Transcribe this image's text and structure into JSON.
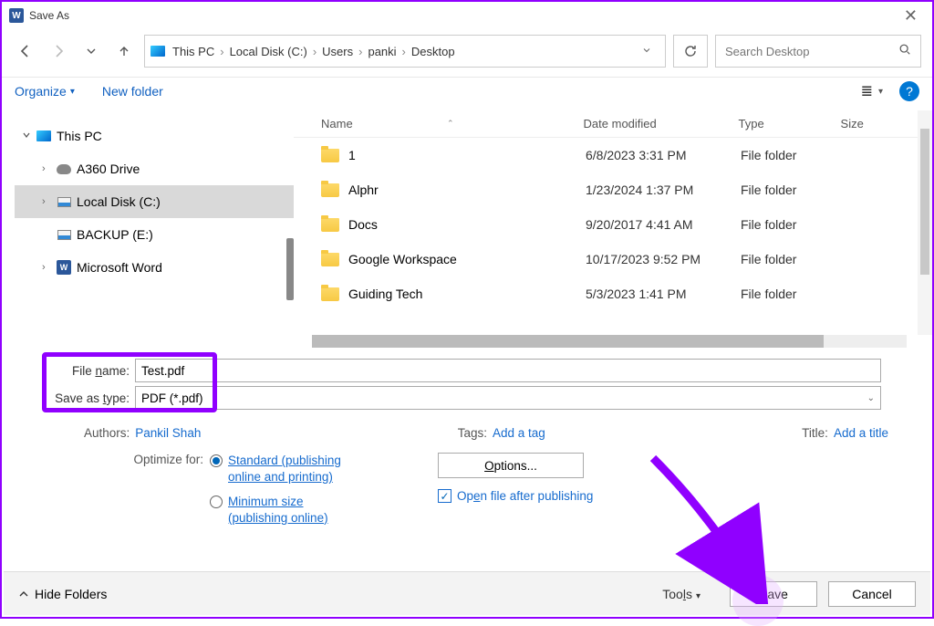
{
  "window": {
    "title": "Save As"
  },
  "breadcrumb": [
    "This PC",
    "Local Disk (C:)",
    "Users",
    "panki",
    "Desktop"
  ],
  "search": {
    "placeholder": "Search Desktop"
  },
  "toolbar": {
    "organize": "Organize",
    "new_folder": "New folder"
  },
  "tree": {
    "root": "This PC",
    "items": [
      {
        "label": "A360 Drive",
        "icon": "cloud"
      },
      {
        "label": "Local Disk (C:)",
        "icon": "disk",
        "selected": true
      },
      {
        "label": "BACKUP (E:)",
        "icon": "disk"
      },
      {
        "label": "Microsoft Word",
        "icon": "word"
      }
    ]
  },
  "columns": {
    "name": "Name",
    "mod": "Date modified",
    "type": "Type",
    "size": "Size"
  },
  "files": [
    {
      "name": "1",
      "mod": "6/8/2023 3:31 PM",
      "type": "File folder"
    },
    {
      "name": "Alphr",
      "mod": "1/23/2024 1:37 PM",
      "type": "File folder"
    },
    {
      "name": "Docs",
      "mod": "9/20/2017 4:41 AM",
      "type": "File folder"
    },
    {
      "name": "Google Workspace",
      "mod": "10/17/2023 9:52 PM",
      "type": "File folder"
    },
    {
      "name": "Guiding Tech",
      "mod": "5/3/2023 1:41 PM",
      "type": "File folder"
    }
  ],
  "form": {
    "filename_label": "File name:",
    "filename_value": "Test.pdf",
    "type_label": "Save as type:",
    "type_value": "PDF (*.pdf)",
    "authors_label": "Authors:",
    "authors_value": "Pankil Shah",
    "tags_label": "Tags:",
    "tags_value": "Add a tag",
    "title_label": "Title:",
    "title_value": "Add a title",
    "optimize_label": "Optimize for:",
    "radio1": "Standard (publishing online and printing)",
    "radio2": "Minimum size (publishing online)",
    "options_btn": "Options...",
    "open_after": "Open file after publishing"
  },
  "bottom": {
    "hide": "Hide Folders",
    "tools": "Tools",
    "save": "Save",
    "cancel": "Cancel"
  }
}
